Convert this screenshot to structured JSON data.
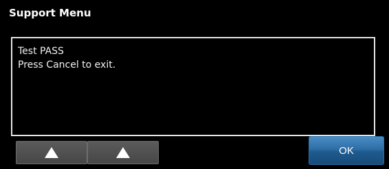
{
  "window": {
    "title": "Support Menu"
  },
  "message": {
    "lines": [
      "Test PASS",
      "Press Cancel to exit."
    ]
  },
  "buttons": {
    "up_left_icon": "up-arrow",
    "up_right_icon": "up-arrow",
    "ok_label": "OK"
  },
  "colors": {
    "background": "#000000",
    "ok_button": "#2e6ea6",
    "arrow_button": "#555555"
  }
}
